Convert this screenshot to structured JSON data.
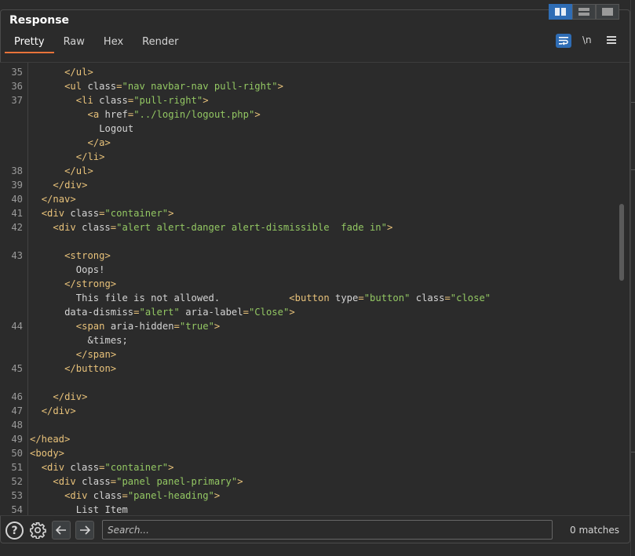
{
  "title": "Response",
  "tabs": [
    {
      "label": "Pretty"
    },
    {
      "label": "Raw"
    },
    {
      "label": "Hex"
    },
    {
      "label": "Render"
    }
  ],
  "toolbar": {
    "newline_label": "\\n"
  },
  "search": {
    "placeholder": "Search...",
    "value": "",
    "matches": "0 matches"
  },
  "colors": {
    "accent": "#2f6db5",
    "active_tab": "#e8733a",
    "tag": "#e8c27a",
    "string": "#93c763"
  },
  "icons": {
    "layout_split_vertical": "columns-icon",
    "layout_split_horizontal": "rows-icon",
    "layout_single": "single-pane-icon",
    "wrap": "word-wrap-icon",
    "menu": "hamburger-icon",
    "help": "help-icon",
    "settings": "gear-icon",
    "prev": "arrow-left-icon",
    "next": "arrow-right-icon"
  },
  "code_lines": [
    {
      "num": "35",
      "indent": 6,
      "parts": [
        [
          "tag",
          "</ul>"
        ]
      ]
    },
    {
      "num": "36",
      "indent": 6,
      "parts": [
        [
          "tag",
          "<ul "
        ],
        [
          "attr",
          "class"
        ],
        [
          "tag",
          "="
        ],
        [
          "val",
          "\"nav navbar-nav pull-right\""
        ],
        [
          "tag",
          ">"
        ]
      ]
    },
    {
      "num": "37",
      "indent": 8,
      "parts": [
        [
          "tag",
          "<li "
        ],
        [
          "attr",
          "class"
        ],
        [
          "tag",
          "="
        ],
        [
          "val",
          "\"pull-right\""
        ],
        [
          "tag",
          ">"
        ]
      ]
    },
    {
      "num": "",
      "indent": 10,
      "parts": [
        [
          "tag",
          "<a "
        ],
        [
          "attr",
          "href"
        ],
        [
          "tag",
          "="
        ],
        [
          "val",
          "\"../login/logout.php\""
        ],
        [
          "tag",
          ">"
        ]
      ]
    },
    {
      "num": "",
      "indent": 12,
      "parts": [
        [
          "txt",
          "Logout"
        ]
      ]
    },
    {
      "num": "",
      "indent": 10,
      "parts": [
        [
          "tag",
          "</a>"
        ]
      ]
    },
    {
      "num": "",
      "indent": 8,
      "parts": [
        [
          "tag",
          "</li>"
        ]
      ]
    },
    {
      "num": "38",
      "indent": 6,
      "parts": [
        [
          "tag",
          "</ul>"
        ]
      ]
    },
    {
      "num": "39",
      "indent": 4,
      "parts": [
        [
          "tag",
          "</div>"
        ]
      ]
    },
    {
      "num": "40",
      "indent": 2,
      "parts": [
        [
          "tag",
          "</nav>"
        ]
      ]
    },
    {
      "num": "41",
      "indent": 2,
      "parts": [
        [
          "tag",
          "<div "
        ],
        [
          "attr",
          "class"
        ],
        [
          "tag",
          "="
        ],
        [
          "val",
          "\"container\""
        ],
        [
          "tag",
          ">"
        ]
      ]
    },
    {
      "num": "42",
      "indent": 4,
      "parts": [
        [
          "tag",
          "<div "
        ],
        [
          "attr",
          "class"
        ],
        [
          "tag",
          "="
        ],
        [
          "val",
          "\"alert alert-danger alert-dismissible  fade in\""
        ],
        [
          "tag",
          ">"
        ]
      ]
    },
    {
      "num": "",
      "indent": 0,
      "parts": []
    },
    {
      "num": "43",
      "indent": 6,
      "parts": [
        [
          "tag",
          "<strong>"
        ]
      ]
    },
    {
      "num": "",
      "indent": 8,
      "parts": [
        [
          "txt",
          "Oops!"
        ]
      ]
    },
    {
      "num": "",
      "indent": 6,
      "parts": [
        [
          "tag",
          "</strong>"
        ]
      ]
    },
    {
      "num": "",
      "indent": 8,
      "parts": [
        [
          "txt",
          "This file is not allowed.            "
        ],
        [
          "tag",
          "<button "
        ],
        [
          "attr",
          "type"
        ],
        [
          "tag",
          "="
        ],
        [
          "val",
          "\"button\""
        ],
        [
          "attr",
          " class"
        ],
        [
          "tag",
          "="
        ],
        [
          "val",
          "\"close\""
        ]
      ]
    },
    {
      "num": "",
      "indent": 6,
      "parts": [
        [
          "attr",
          "data-dismiss"
        ],
        [
          "tag",
          "="
        ],
        [
          "val",
          "\"alert\""
        ],
        [
          "attr",
          " aria-label"
        ],
        [
          "tag",
          "="
        ],
        [
          "val",
          "\"Close\""
        ],
        [
          "tag",
          ">"
        ]
      ]
    },
    {
      "num": "44",
      "indent": 8,
      "parts": [
        [
          "tag",
          "<span "
        ],
        [
          "attr",
          "aria-hidden"
        ],
        [
          "tag",
          "="
        ],
        [
          "val",
          "\"true\""
        ],
        [
          "tag",
          ">"
        ]
      ]
    },
    {
      "num": "",
      "indent": 10,
      "parts": [
        [
          "txt",
          "&times;"
        ]
      ]
    },
    {
      "num": "",
      "indent": 8,
      "parts": [
        [
          "tag",
          "</span>"
        ]
      ]
    },
    {
      "num": "45",
      "indent": 6,
      "parts": [
        [
          "tag",
          "</button>"
        ]
      ]
    },
    {
      "num": "",
      "indent": 0,
      "parts": []
    },
    {
      "num": "46",
      "indent": 4,
      "parts": [
        [
          "tag",
          "</div>"
        ]
      ]
    },
    {
      "num": "47",
      "indent": 2,
      "parts": [
        [
          "tag",
          "</div>"
        ]
      ]
    },
    {
      "num": "48",
      "indent": 0,
      "parts": []
    },
    {
      "num": "49",
      "indent": 0,
      "parts": [
        [
          "tag",
          "</head>"
        ]
      ]
    },
    {
      "num": "50",
      "indent": 0,
      "parts": [
        [
          "tag",
          "<body>"
        ]
      ]
    },
    {
      "num": "51",
      "indent": 2,
      "parts": [
        [
          "tag",
          "<div "
        ],
        [
          "attr",
          "class"
        ],
        [
          "tag",
          "="
        ],
        [
          "val",
          "\"container\""
        ],
        [
          "tag",
          ">"
        ]
      ]
    },
    {
      "num": "52",
      "indent": 4,
      "parts": [
        [
          "tag",
          "<div "
        ],
        [
          "attr",
          "class"
        ],
        [
          "tag",
          "="
        ],
        [
          "val",
          "\"panel panel-primary\""
        ],
        [
          "tag",
          ">"
        ]
      ]
    },
    {
      "num": "53",
      "indent": 6,
      "parts": [
        [
          "tag",
          "<div "
        ],
        [
          "attr",
          "class"
        ],
        [
          "tag",
          "="
        ],
        [
          "val",
          "\"panel-heading\""
        ],
        [
          "tag",
          ">"
        ]
      ]
    },
    {
      "num": "54",
      "indent": 8,
      "parts": [
        [
          "txt",
          "List Item"
        ]
      ]
    }
  ]
}
